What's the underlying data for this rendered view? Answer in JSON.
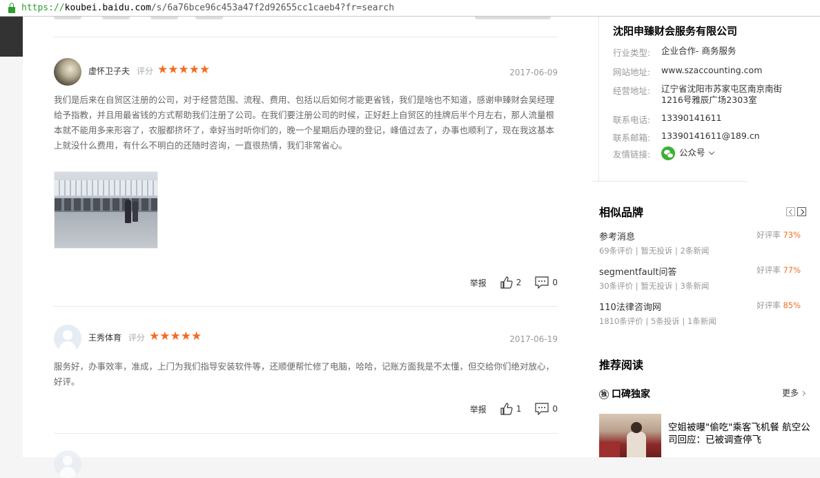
{
  "browser": {
    "url_scheme": "https://",
    "url_host": "koubei.baidu.com",
    "url_path": "/s/6a76bce96c453a47f2d92655cc1caeb4?fr=search"
  },
  "reviews": [
    {
      "username": "虚怀卫子夫",
      "rating_label": "评分",
      "stars": "★★★★★",
      "rating": 5,
      "date": "2017-06-09",
      "text": "我们是后来在自贸区注册的公司，对于经营范围、流程、费用、包括以后如何才能更省钱，我们是啥也不知道，感谢申臻财会吴经理给予指教，并且用最省钱的方式帮助我们注册了公司。在我们要注册公司的时候，正好赶上自贸区的挂牌后半个月左右，那人流量根本就不能用多来形容了，农服都挤坏了，幸好当时听你们的，晚一个星期后办理的登记，峰值过去了，办事也顺利了，现在我这基本上就没什么费用，有什么不明白的还随时咨询，一直很热情，我们非常省心。",
      "report_label": "举报",
      "likes": "2",
      "comments": "0"
    },
    {
      "username": "王秀体育",
      "rating_label": "评分",
      "stars": "★★★★★",
      "rating": 5,
      "date": "2017-06-19",
      "text": "服务好，办事效率，准成，上门为我们指导安装软件等，还顺便帮忙修了电脑，哈哈，记账方面我是不太懂，但交给你们绝对放心，好评。",
      "report_label": "举报",
      "likes": "1",
      "comments": "0"
    }
  ],
  "company": {
    "name": "沈阳申臻财会服务有限公司",
    "industry_label": "行业类型:",
    "industry": "企业合作- 商务服务",
    "website_label": "网站地址:",
    "website": "www.szaccounting.com",
    "address_label": "经营地址:",
    "address": "辽宁省沈阳市苏家屯区南京南街1216号雅辰广场2303室",
    "phone_label": "联系电话:",
    "phone": "13390141611",
    "email_label": "联系邮箱:",
    "email": "13390141611@189.cn",
    "links_label": "友情链接:",
    "links_value": "公众号"
  },
  "similar": {
    "title": "相似品牌",
    "brands": [
      {
        "name": "参考消息",
        "stats": "69条评价 | 暂无投诉 | 2条新闻",
        "rate_label": "好评率",
        "rate": "73%"
      },
      {
        "name": "segmentfault问答",
        "stats": "30条评价 | 暂无投诉 | 3条新闻",
        "rate_label": "好评率",
        "rate": "77%"
      },
      {
        "name": "110法律咨询网",
        "stats": "1810条评价 | 5条投诉 | 1条新闻",
        "rate_label": "好评率",
        "rate": "85%"
      }
    ]
  },
  "recommended": {
    "title": "推荐阅读",
    "section": "口碑独家",
    "section_icon_text": "独",
    "more_label": "更多",
    "article_title": "空姐被曝\"偷吃\"乘客飞机餐 航空公司回应：已被调查停飞"
  },
  "colors": {
    "accent": "#f36c21",
    "secure_green": "#2e9e2e",
    "wechat_green": "#3cb034"
  }
}
